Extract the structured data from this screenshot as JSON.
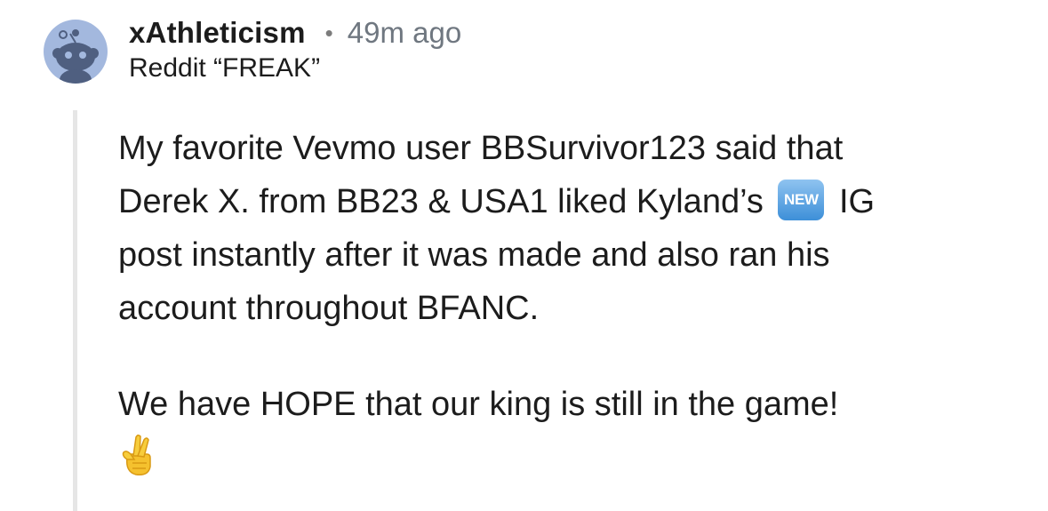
{
  "comment": {
    "username": "xAthleticism",
    "separator": "•",
    "timestamp": "49m ago",
    "flair": "Reddit “FREAK”",
    "avatar_icon": "reddit-snoo-avatar-icon",
    "body": {
      "line_1": "My favorite Vevmo user BBSurvivor123 said that",
      "line_2_before": "Derek X. from BB23 & USA1 liked Kyland’s",
      "new_badge": "NEW",
      "line_2_after": "IG",
      "line_3": "post instantly after it was made and also ran his",
      "line_4": "account throughout BFANC.",
      "line_5": "We have HOPE that our king is still in the game!",
      "emoji": "crossed-fingers-emoji-icon"
    }
  },
  "colors": {
    "avatar_bg": "#a3b8de",
    "snoo": "#4f5f80",
    "thread_line": "#e6e6e6",
    "timestamp": "#6f7780",
    "new_badge": "#4a98dc"
  }
}
